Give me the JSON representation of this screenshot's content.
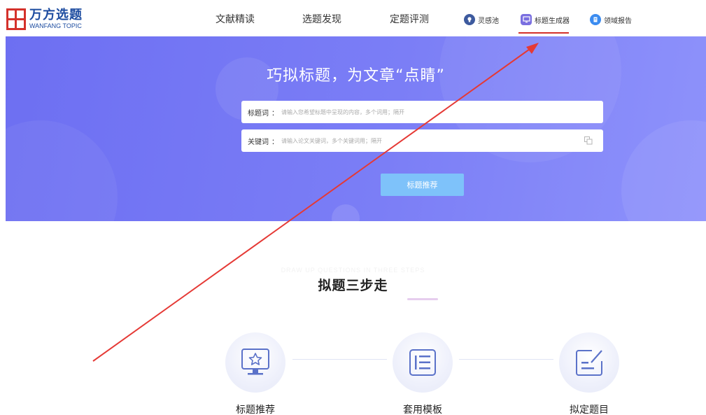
{
  "brand": {
    "name_cn": "万方选题",
    "name_en": "WANFANG TOPIC",
    "color": "#d4312b",
    "text_color": "#1d4ca0"
  },
  "nav": {
    "items": [
      {
        "label": "文献精读"
      },
      {
        "label": "选题发现"
      },
      {
        "label": "定题评测"
      }
    ],
    "icon_items": [
      {
        "label": "灵感池",
        "icon": "lightbulb-icon",
        "active": false
      },
      {
        "label": "标题生成器",
        "icon": "monitor-icon",
        "active": true
      },
      {
        "label": "领域报告",
        "icon": "document-icon",
        "active": false
      }
    ]
  },
  "hero": {
    "title": "巧拟标题，为文章“点睛”",
    "fields": [
      {
        "label": "标题词",
        "colon": "：",
        "placeholder": "请输入您希望标题中呈现的内容，多个词用；隔开"
      },
      {
        "label": "关键词",
        "colon": "：",
        "placeholder": "请输入论文关键词，多个关键词用；隔开"
      }
    ],
    "submit_label": "标题推荐",
    "colors": {
      "bg_start": "#6d6ff2",
      "bg_end": "#8e92fb",
      "button": "#7ec2fa"
    }
  },
  "steps": {
    "subtitle": "DRAW UP QUESTIONS IN THREE STEPS",
    "title": "拟题三步走",
    "items": [
      {
        "label": "标题推荐",
        "icon": "star-monitor-icon"
      },
      {
        "label": "套用模板",
        "icon": "template-list-icon"
      },
      {
        "label": "拟定题目",
        "icon": "edit-document-icon"
      }
    ]
  },
  "annotation": {
    "type": "arrow",
    "color": "#e53935"
  }
}
